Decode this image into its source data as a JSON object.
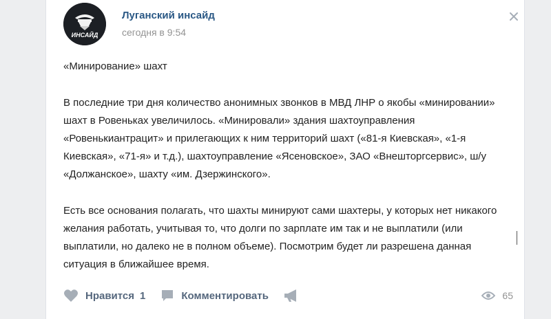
{
  "post": {
    "author": "Луганский инсайд",
    "date": "сегодня в 9:54",
    "avatar_text": "ИНСАЙД",
    "title": "«Минирование» шахт",
    "paragraphs": [
      "В последние три дня количество анонимных звонков в МВД ЛНР о якобы «минировании» шахт в Ровеньках увеличилось. «Минировали» здания шахтоуправления «Ровенькиантрацит» и прилегающих к ним территорий шахт («81-я Киевская», «1-я Киевская», «71-я» и т.д.), шахтоуправление «Ясеновское», ЗАО «Внешторгсервис», ш/у «Должанское», шахту «им. Дзержинского».",
      "Есть все основания полагать, что шахты минируют сами шахтеры, у которых нет никакого желания работать, учитывая то, что долги по зарплате им так и не выплатили (или выплатили, но далеко не в полном объеме). Посмотрим будет ли разрешена данная ситуация в ближайшее время."
    ]
  },
  "actions": {
    "like_label": "Нравится",
    "like_count": "1",
    "comment_label": "Комментировать",
    "views_count": "65"
  },
  "icons": {
    "more": "more-icon",
    "like": "heart-icon",
    "comment": "comment-icon",
    "share": "megaphone-icon",
    "views": "eye-icon"
  },
  "colors": {
    "link": "#2a5885",
    "muted": "#939393",
    "action": "#55677d",
    "icon": "#a6aeb7",
    "background": "#edeef0"
  }
}
